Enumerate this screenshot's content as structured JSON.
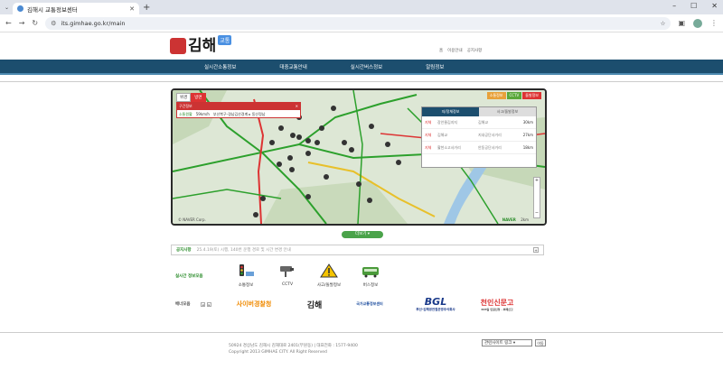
{
  "browser": {
    "tab_title": "김해시 교통정보센터",
    "url": "its.gimhae.go.kr/main"
  },
  "header": {
    "logo_text": "김해",
    "logo_badge": "교통",
    "util_links": [
      "홈",
      "이용안내",
      "공지사항"
    ]
  },
  "gnb": [
    "실시간소통정보",
    "대중교통안내",
    "실시간버스정보",
    "알림정보"
  ],
  "map": {
    "tabs": [
      "위경",
      "방면"
    ],
    "legend": [
      {
        "label": "소통정보",
        "color": "#e8a13a"
      },
      {
        "label": "CCTV",
        "color": "#5aa83a"
      },
      {
        "label": "돌발정보",
        "color": "#d33"
      }
    ],
    "section": {
      "title": "구간정보",
      "status": "소통원활",
      "speed": "59km/h",
      "route": "부산북구-경남김산경계 ▸ 동산정남"
    },
    "congestion": {
      "tabs": [
        "지/정체정보",
        "사고/돌발정보"
      ],
      "rows": [
        {
          "level": "지체",
          "from": "장안물김지지",
          "to": "김해교",
          "speed": "30km"
        },
        {
          "level": "지체",
          "from": "김해교",
          "to": "지내공단사거리",
          "speed": "27km"
        },
        {
          "level": "지체",
          "from": "활천소고사거리",
          "to": "안동공단사거리",
          "speed": "18km"
        }
      ]
    },
    "footer_left": "© NAVER Corp.",
    "footer_right": "NAVER",
    "scale": "2km"
  },
  "more_button": "더보기 ▾",
  "notice": {
    "title": "공지사항",
    "text": "25.4.19(토) 시행, 140번 운행 경로 및 시간 변경 안내"
  },
  "realtime": {
    "label": "실시간 정보모음",
    "items": [
      "소통정보",
      "CCTV",
      "사고/돌발정보",
      "버스정보"
    ]
  },
  "banners": {
    "label": "배너모음",
    "items": [
      "사이버경찰청",
      "김해",
      "국가교통정보센터",
      "BGL",
      "천인신문고"
    ],
    "bgl_sub": "부산-김해경전철운영주식회사",
    "chun_sub": "365일 민원신청 · 부패신고"
  },
  "footer": {
    "address": "50924 경상남도 김해시 김해대로 2401(부원동) | 대표전화 : 1577-9400",
    "copyright": "Copyright 2013 GIMHAE CITY. All Right Reserved",
    "related_select": "관련사이트 링크",
    "go": "이동"
  }
}
